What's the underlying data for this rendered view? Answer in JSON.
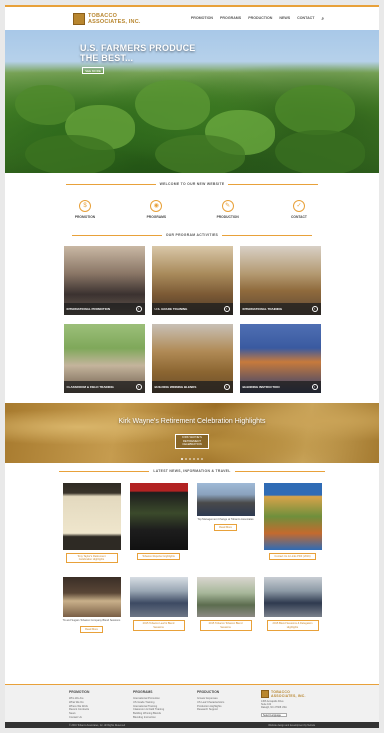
{
  "brand": {
    "name_line1": "TOBACCO",
    "name_line2": "ASSOCIATES, INC.",
    "accent": "#e8a13a"
  },
  "nav": {
    "items": [
      "PROMOTION",
      "PROGRAMS",
      "PRODUCTION",
      "NEWS",
      "CONTACT"
    ],
    "search_icon": "search-icon"
  },
  "hero": {
    "title_line1": "U.S. FARMERS PRODUCE",
    "title_line2": "THE BEST...",
    "button": "SEE MORE"
  },
  "welcome": {
    "heading": "WELCOME TO OUR NEW WEBSITE",
    "items": [
      {
        "label": "PROMOTION",
        "icon": "promotion-icon"
      },
      {
        "label": "PROGRAMS",
        "icon": "programs-icon"
      },
      {
        "label": "PRODUCTION",
        "icon": "production-icon"
      },
      {
        "label": "CONTACT",
        "icon": "contact-icon"
      }
    ]
  },
  "programs": {
    "heading": "OUR PROGRAM ACTIVITIES",
    "items": [
      {
        "label": "INTERNATIONAL PROMOTION"
      },
      {
        "label": "U.S. GRADE TRAINING"
      },
      {
        "label": "INTERNATIONAL TRAINING"
      },
      {
        "label": "CLASSROOM & FIELD TRAINING"
      },
      {
        "label": "BUILDING WINNING BLENDS"
      },
      {
        "label": "BLENDING INSTRUCTION"
      }
    ]
  },
  "banner": {
    "title": "Kirk Wayne's Retirement Celebration Highlights",
    "button": "KIRK WAYNE'S RETIREMENT CELEBRATION"
  },
  "news": {
    "heading": "LATEST NEWS, INFORMATION & TRAVEL",
    "row1": [
      {
        "caption": "",
        "button": "Tony Taylor's Retirement Celebration Highlights"
      },
      {
        "caption": "",
        "button": "Tobacco Reporter Highlights"
      },
      {
        "caption": "Top Management Change at Tobacco Associates",
        "button": "Read More"
      },
      {
        "caption": "",
        "button": "Contact Us & Links PDF (2016)"
      }
    ],
    "row2": [
      {
        "caption": "TA and Sugars Tobacco Company Blend Sessions",
        "button": "Read More"
      },
      {
        "caption": "",
        "button": "2015 Tobacco Leaf & Blend Sessions"
      },
      {
        "caption": "",
        "button": "2015 Tobacco Tobacco Blend Sessions"
      },
      {
        "caption": "",
        "button": "2015 Blend Sessions & Delegation Highlights"
      }
    ]
  },
  "footer": {
    "columns": [
      {
        "heading": "PROMOTION",
        "links": [
          "Who We Are",
          "What We Do",
          "Where We Work",
          "Recent Contracts",
          "News",
          "Contact Us"
        ]
      },
      {
        "heading": "PROGRAMS",
        "links": [
          "International Promotion",
          "US Grade Training",
          "International Training",
          "Classroom & Field Training",
          "Building Winning Blends",
          "Blending Instruction"
        ]
      },
      {
        "heading": "PRODUCTION",
        "links": [
          "Grower Expenses",
          "US Leaf Characteristics",
          "Production Highlights",
          "Research Support"
        ]
      }
    ],
    "address": [
      "1306 Annapolis Drive",
      "Suite 102",
      "Raleigh, NC 27608 USA"
    ],
    "language_select": "Select Language",
    "copyright": "© 2016 Tobacco Associates, Inc. All Rights Reserved",
    "credit": "Website design and development by Nebula"
  }
}
